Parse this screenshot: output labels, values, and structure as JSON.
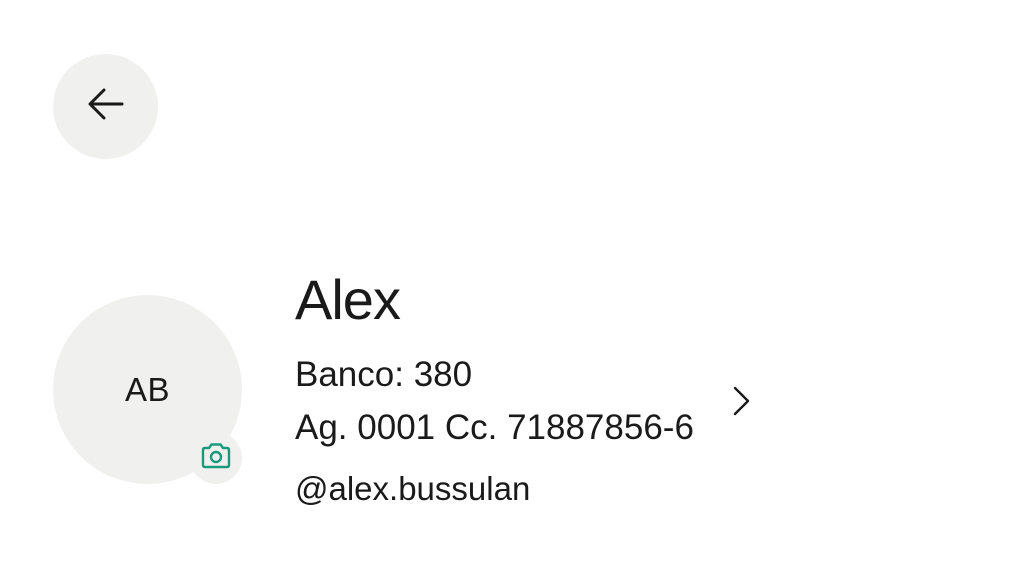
{
  "header": {
    "back_icon": "arrow-left-icon"
  },
  "profile": {
    "initials": "AB",
    "camera_icon": "camera-icon",
    "accent_color": "#1a9a7a",
    "name": "Alex",
    "bank_line": "Banco: 380",
    "account_line": "Ag. 0001 Cc. 71887856-6",
    "chevron_icon": "chevron-right-icon",
    "handle": "@alex.bussulan"
  }
}
